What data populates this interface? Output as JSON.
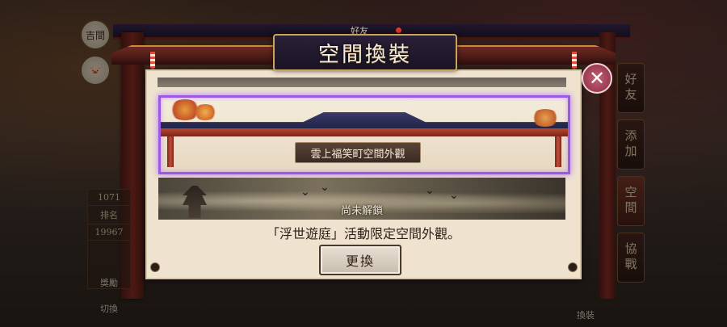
{
  "background": {
    "left_buttons": [
      {
        "label": "吉間",
        "icon": "courtyard-icon"
      },
      {
        "label": "",
        "icon": "pig-avatar-icon"
      }
    ],
    "rank": {
      "value1": "1071",
      "label": "排名",
      "value2": "19967"
    },
    "bottom_left_labels": [
      "獎勵",
      "切換"
    ],
    "bottom_right_label": "換裝",
    "right_tabs": [
      "好友",
      "添加",
      "空間",
      "協戰"
    ]
  },
  "modal": {
    "title": "空間換裝",
    "friend_tag": "好友",
    "close_label": "✕",
    "options": [
      {
        "label": "雲上福笑町空間外觀",
        "selected": true,
        "locked": false
      },
      {
        "label": "尚未解鎖",
        "selected": false,
        "locked": true
      }
    ],
    "description": "「浮世遊庭」活動限定空間外觀。",
    "change_button": "更換"
  },
  "colors": {
    "selected_border": "#9a5ae6",
    "panel_bg": "#efe3cf",
    "close_button": "#c26076"
  }
}
